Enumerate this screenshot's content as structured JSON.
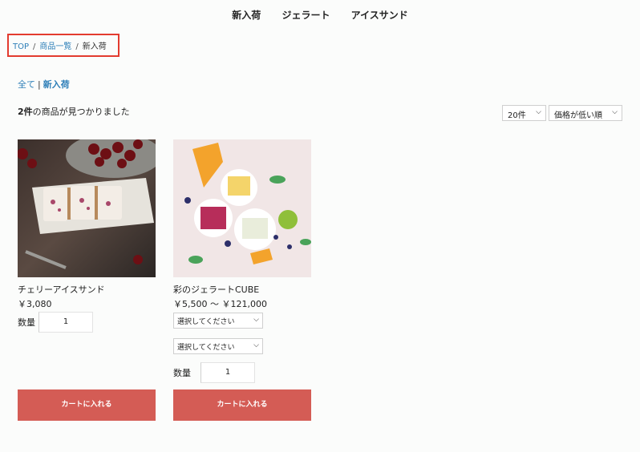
{
  "nav": {
    "items": [
      "新入荷",
      "ジェラート",
      "アイスサンド"
    ]
  },
  "breadcrumb": {
    "top": "TOP",
    "list": "商品一覧",
    "current": "新入荷",
    "sep": "/"
  },
  "category": {
    "all": "全て",
    "bar": "|",
    "current": "新入荷"
  },
  "results": {
    "count": "2件",
    "text": "の商品が見つかりました"
  },
  "sort": {
    "per_page": "20件",
    "order": "価格が低い順"
  },
  "products": [
    {
      "name": "チェリーアイスサンド",
      "price": "￥3,080",
      "qty_label": "数量",
      "qty": "1",
      "cart": "カートに入れる"
    },
    {
      "name": "彩のジェラートCUBE",
      "price": "￥5,500 ～ ￥121,000",
      "option1": "選択してください",
      "option2": "選択してください",
      "qty_label": "数量",
      "qty": "1",
      "cart": "カートに入れる"
    }
  ],
  "icons": {
    "dropdown": "chevron-down-icon"
  },
  "colors": {
    "accent": "#d45c55",
    "link": "#2e7fb8",
    "highlight": "#e33b2f"
  }
}
